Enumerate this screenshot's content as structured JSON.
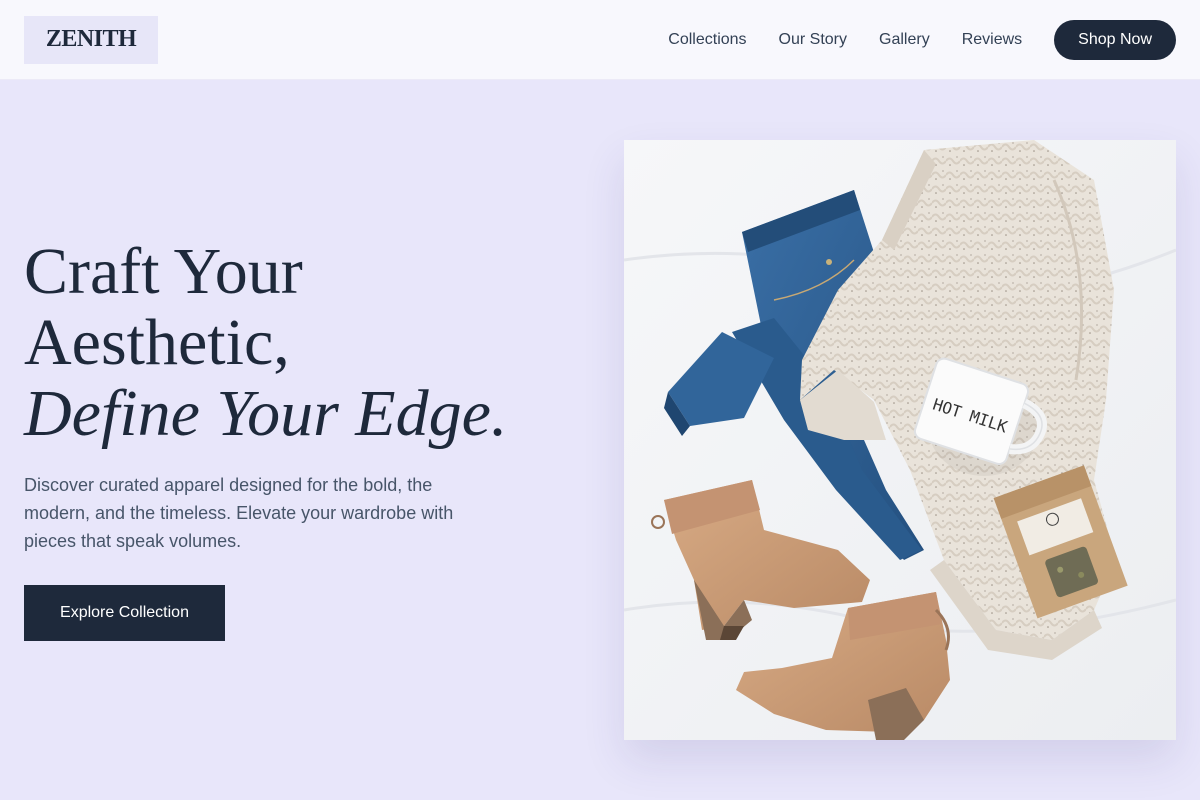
{
  "header": {
    "logo": "ZENITH",
    "nav": [
      {
        "label": "Collections"
      },
      {
        "label": "Our Story"
      },
      {
        "label": "Gallery"
      },
      {
        "label": "Reviews"
      }
    ],
    "cta_label": "Shop Now"
  },
  "hero": {
    "headline_line1": "Craft Your",
    "headline_line2": "Aesthetic,",
    "headline_line3": "Define Your Edge.",
    "subtext": "Discover curated apparel designed for the bold, the modern, and the timeless. Elevate your wardrobe with pieces that speak volumes.",
    "cta_label": "Explore Collection"
  },
  "photo": {
    "mug_text": "HOT MILK"
  },
  "colors": {
    "background": "#e8e6fa",
    "header_bg": "#f8f8fd",
    "primary_dark": "#1e293b",
    "denim": "#2d5f92",
    "suede": "#c99c77",
    "sweater": "#e9e2d9"
  }
}
